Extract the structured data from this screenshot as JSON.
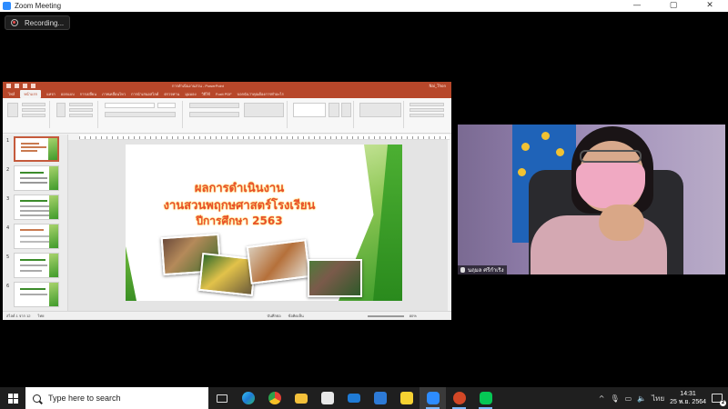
{
  "zoom": {
    "window_title": "Zoom Meeting",
    "controls": {
      "minimize": "—",
      "restore": "▢",
      "close": "✕"
    },
    "recording_label": "Recording..."
  },
  "powerpoint": {
    "window_title": "การดำเนินงานสวน - PowerPoint",
    "user": "Nai_Thon",
    "tabs": [
      "ไฟล์",
      "หน้าแรก",
      "แทรก",
      "ออกแบบ",
      "การเปลี่ยน",
      "ภาพเคลื่อนไหว",
      "การนำเสนอสไลด์",
      "ตรวจทาน",
      "มุมมอง",
      "วิธีใช้",
      "Foxit PDF",
      "บอกฉันว่าคุณต้องการทำอะไร"
    ],
    "active_tab_index": 1,
    "slide_numbers": [
      "1",
      "2",
      "3",
      "4",
      "5",
      "6"
    ],
    "selected_slide": "1",
    "slide_title_lines": [
      "ผลการดำเนินงาน",
      "งานสวนพฤกษศาสตร์โรงเรียน",
      "ปีการศึกษา 2563"
    ],
    "status": {
      "slide_counter": "สไลด์ 1 จาก 12",
      "language": "ไทย",
      "notes": "บันทึกย่อ",
      "comments": "ข้อคิดเห็น",
      "zoom": "80%"
    },
    "accent_color": "#b7472a"
  },
  "video": {
    "participant_name": "นฤมล ศรีกำเริง"
  },
  "taskbar": {
    "search_placeholder": "Type here to search",
    "apps": [
      "task-view-icon",
      "edge-icon",
      "chrome-icon",
      "file-explorer-icon",
      "store-icon",
      "mail-icon",
      "calendar-icon",
      "sticky-notes-icon",
      "zoom-icon",
      "powerpoint-icon",
      "line-icon"
    ],
    "tray_language": "ไทย",
    "time": "14:31",
    "date": "25 พ.ย. 2564",
    "notification_count": "2"
  }
}
